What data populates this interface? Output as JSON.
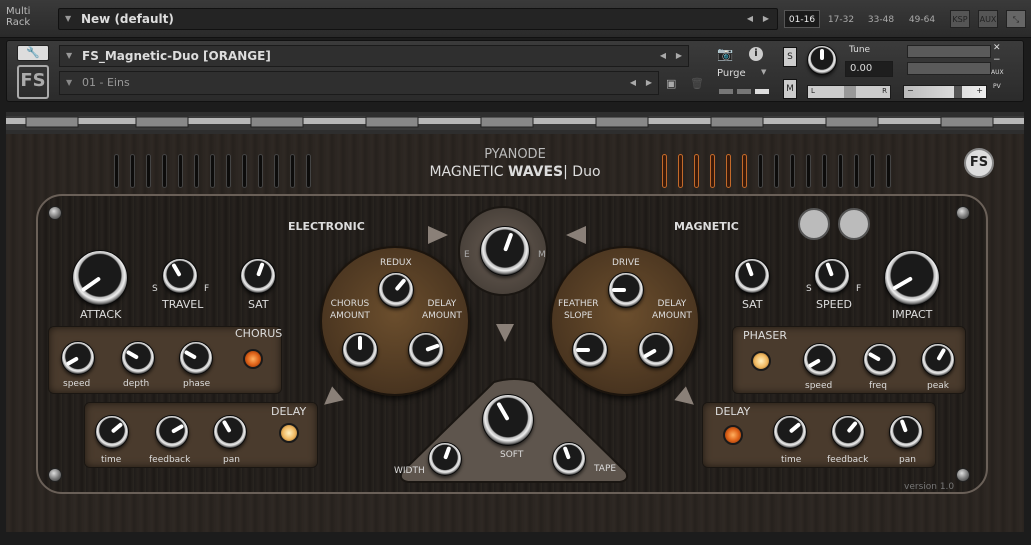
{
  "rack": {
    "label_line1": "Multi",
    "label_line2": "Rack",
    "preset_name": "New (default)",
    "ranges": [
      "01-16",
      "17-32",
      "33-48",
      "49-64"
    ],
    "ksp": "KSP",
    "aux": "AUX"
  },
  "instrument": {
    "name": "FS_Magnetic-Duo [ORANGE]",
    "patch": "01 - Eins",
    "purge": "Purge",
    "tune_label": "Tune",
    "tune_value": "0.00",
    "solo": "S",
    "mute": "M",
    "pan_left": "L",
    "pan_right": "R",
    "aux_tag": "AUX",
    "pv_tag": "PV"
  },
  "panel": {
    "brand_top": "PYANODE",
    "brand_main_a": "MAGNETIC ",
    "brand_main_b": "WAVES",
    "brand_main_c": "| Duo",
    "version": "version 1.0",
    "electronic": "ELECTRONIC",
    "magnetic": "MAGNETIC",
    "e": "E",
    "m": "M",
    "attack": "ATTACK",
    "travel": "TRAVEL",
    "s1": "S",
    "f1": "F",
    "sat_l": "SAT",
    "chorus": "CHORUS",
    "speed1": "speed",
    "depth": "depth",
    "phase": "phase",
    "delay_l": "DELAY",
    "time1": "time",
    "feedback1": "feedback",
    "pan1": "pan",
    "redux": "REDUX",
    "chorus_amount": "CHORUS\nAMOUNT",
    "delay_amount_l": "DELAY\nAMOUNT",
    "drive": "DRIVE",
    "feather_slope": "FEATHER\nSLOPE",
    "delay_amount_r": "DELAY\nAMOUNT",
    "sat_r": "SAT",
    "speed_r": "SPEED",
    "s2": "S",
    "f2": "F",
    "impact": "IMPACT",
    "phaser": "PHASER",
    "speed2": "speed",
    "freq": "freq",
    "peak": "peak",
    "delay_r": "DELAY",
    "time2": "time",
    "feedback2": "feedback",
    "pan2": "pan",
    "width": "WIDTH",
    "soft": "SOFT",
    "tape": "TAPE"
  },
  "colors": {
    "led_orange": "#e0641a",
    "led_amber": "#f0b860",
    "disc": "#5a4128",
    "box": "#4a3b2d"
  }
}
